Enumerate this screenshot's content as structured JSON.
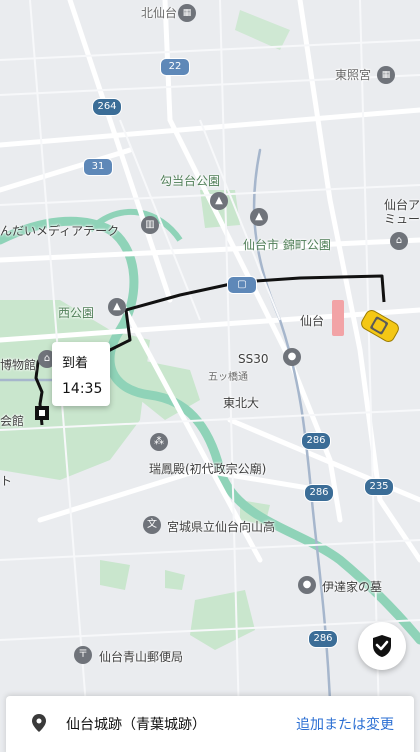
{
  "map_labels": {
    "kitasendai": "北仙台",
    "route22": "22",
    "route264": "264",
    "route31": "31",
    "higashi_shogu": "東照宮",
    "koutodai_park": "勾当台公園",
    "mediatheque": "んだいメディアテーク",
    "sendai_ai": "仙台ア",
    "museum": "ミュー",
    "sendai_city_park": "仙台市 錦町公園",
    "sendai_station": "仙台",
    "nishi_park": "西公園",
    "hakubutsukan": "博物館",
    "kaikan": "会館",
    "ss30": "SS30",
    "gokyo": "五ッ橋通",
    "tohoku_univ": "東北大",
    "route286a": "286",
    "route235": "235",
    "route286b": "286",
    "zuihoden": "瑞鳳殿(初代政宗公廟)",
    "high_school": "宮城県立仙台向山高",
    "date_grave": "伊達家の墓",
    "route286c": "286",
    "post_office": "仙台青山郵便局",
    "left_edge": "ト"
  },
  "eta_bubble": {
    "title": "到着",
    "time": "14:35"
  },
  "bottom_sheet": {
    "destination": "仙台城跡（青葉城跡）",
    "action": "追加または変更"
  },
  "icons": {
    "safety": "shield-check-icon",
    "pin": "location-pin-icon",
    "car": "taxi-car-icon"
  },
  "colors": {
    "route": "#111111",
    "link": "#2b6fd3",
    "park": "#c9e6cd",
    "river": "#8fd3b8"
  }
}
